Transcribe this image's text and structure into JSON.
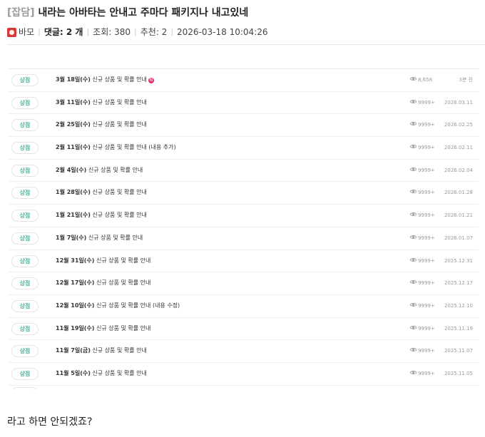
{
  "post": {
    "category": "[잡담]",
    "title": "내라는 아바타는 안내고 주마다 패키지나 내고있네",
    "author": "바모",
    "comments_label": "댓글: ",
    "comments_count": "2 개",
    "views": "조회: 380",
    "recommends": "추천: 2",
    "datetime": "2026-03-18 10:04:26"
  },
  "notices": [
    {
      "tag": "상점",
      "date_part": "3월 18일(수)",
      "rest": " 신규 상품 및 확률 안내",
      "is_new": true,
      "new_badge": "N",
      "views": "8,658",
      "date": "3분 전"
    },
    {
      "tag": "상점",
      "date_part": "3월 11일(수)",
      "rest": " 신규 상품 및 확률 안내",
      "is_new": false,
      "views": "9999+",
      "date": "2026.03.11"
    },
    {
      "tag": "상점",
      "date_part": "2월 25일(수)",
      "rest": " 신규 상품 및 확률 안내",
      "is_new": false,
      "views": "9999+",
      "date": "2026.02.25"
    },
    {
      "tag": "상점",
      "date_part": "2월 11일(수)",
      "rest": " 신규 상품 및 확률 안내 (내용 추가)",
      "is_new": false,
      "views": "9999+",
      "date": "2026.02.11"
    },
    {
      "tag": "상점",
      "date_part": "2월 4일(수)",
      "rest": " 신규 상품 및 확률 안내",
      "is_new": false,
      "views": "9999+",
      "date": "2026.02.04"
    },
    {
      "tag": "상점",
      "date_part": "1월 28일(수)",
      "rest": " 신규 상품 및 확률 안내",
      "is_new": false,
      "views": "9999+",
      "date": "2026.01.28"
    },
    {
      "tag": "상점",
      "date_part": "1월 21일(수)",
      "rest": " 신규 상품 및 확률 안내",
      "is_new": false,
      "views": "9999+",
      "date": "2026.01.21"
    },
    {
      "tag": "상점",
      "date_part": "1월 7일(수)",
      "rest": " 신규 상품 및 확률 안내",
      "is_new": false,
      "views": "9999+",
      "date": "2026.01.07"
    },
    {
      "tag": "상점",
      "date_part": "12월 31일(수)",
      "rest": " 신규 상품 및 확률 안내",
      "is_new": false,
      "views": "9999+",
      "date": "2025.12.31"
    },
    {
      "tag": "상점",
      "date_part": "12월 17일(수)",
      "rest": " 신규 상품 및 확률 안내",
      "is_new": false,
      "views": "9999+",
      "date": "2025.12.17"
    },
    {
      "tag": "상점",
      "date_part": "12월 10일(수)",
      "rest": " 신규 상품 및 확률 안내 (내용 수정)",
      "is_new": false,
      "views": "9999+",
      "date": "2025.12.10"
    },
    {
      "tag": "상점",
      "date_part": "11월 19일(수)",
      "rest": " 신규 상품 및 확률 안내",
      "is_new": false,
      "views": "9999+",
      "date": "2025.11.19"
    },
    {
      "tag": "상점",
      "date_part": "11월 7일(금)",
      "rest": " 신규 상품 및 확률 안내",
      "is_new": false,
      "views": "9999+",
      "date": "2025.11.07"
    },
    {
      "tag": "상점",
      "date_part": "11월 5일(수)",
      "rest": " 신규 상품 및 확률 안내",
      "is_new": false,
      "views": "9999+",
      "date": "2025.11.05"
    }
  ],
  "body_text": "라고 하면 안되겠죠?",
  "colors": {
    "tag_text": "#48b6a2",
    "new_badge": "#e8326e",
    "avatar": "#d23a3a"
  }
}
